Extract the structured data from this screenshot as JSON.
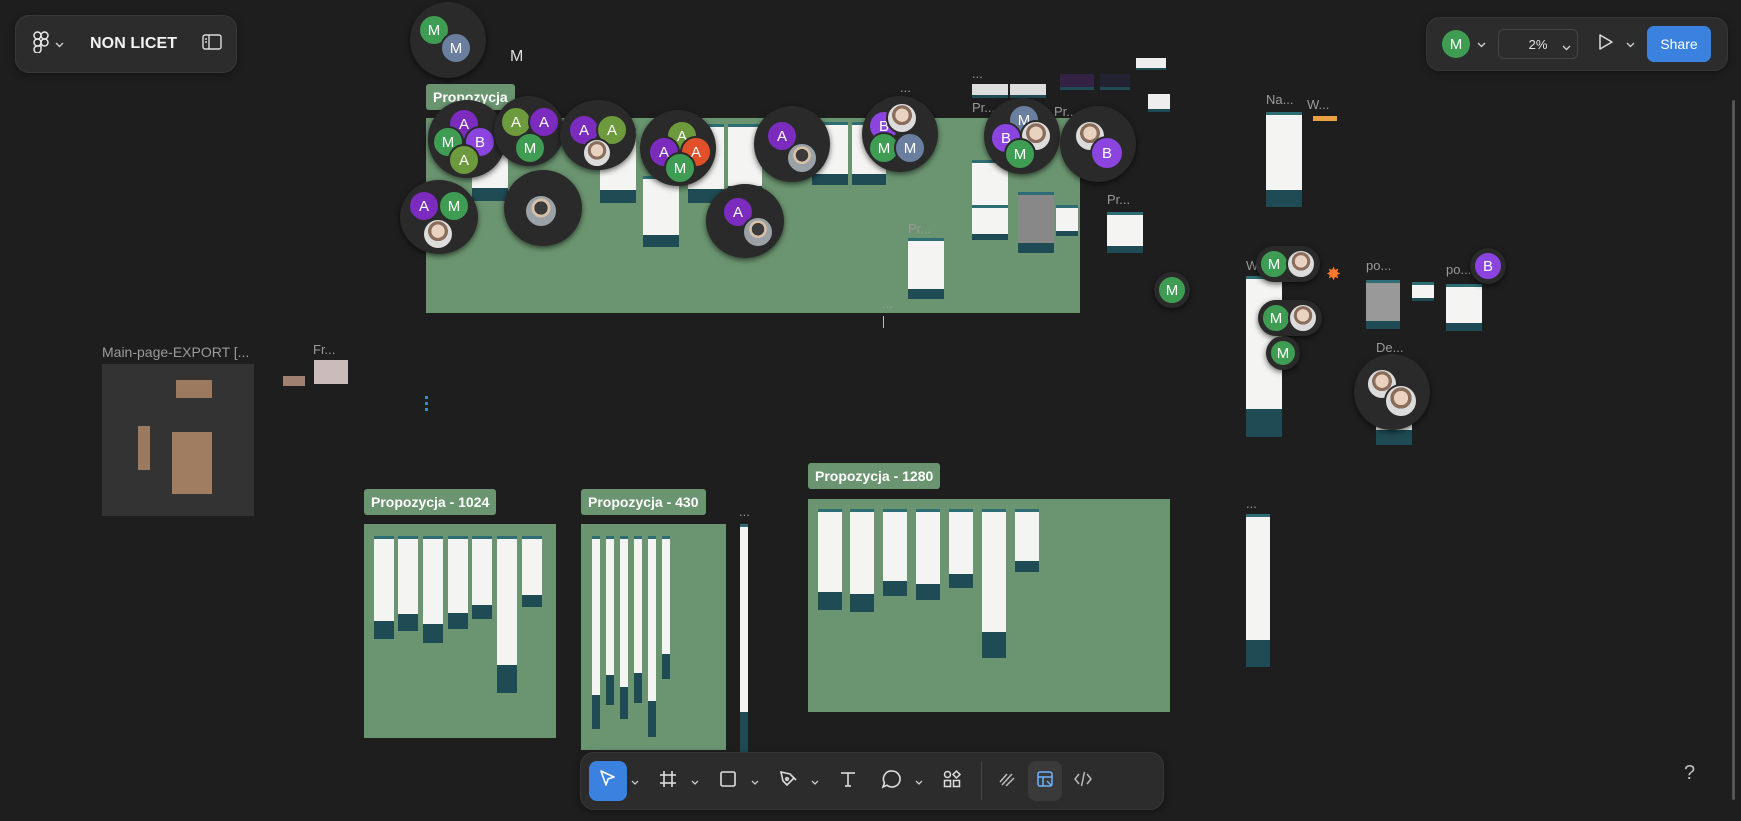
{
  "toolbar": {
    "file_name": "NON LICET",
    "zoom_level": "2%",
    "share_label": "Share",
    "current_user_initial": "M",
    "icons": [
      "figma-logo-icon",
      "chevron-down-icon",
      "sidebar-toggle-icon",
      "play-icon"
    ]
  },
  "frames": [
    {
      "label": "Propozycja - 1024"
    },
    {
      "label": "Propozycja - 430"
    },
    {
      "label": "Propozycja - 1280"
    },
    {
      "label": "Propozycja"
    }
  ],
  "captions": {
    "main_export": "Main-page-EXPORT [...",
    "fr": "Fr...",
    "pr1": "Pr...",
    "pr2": "Pr...",
    "pr3": "Pr...",
    "pr4": "Pr...",
    "dots1": "...",
    "dots2": "...",
    "dots3": "...",
    "dots4": "...",
    "na": "Na...",
    "w1": "W...",
    "w2": "W",
    "po1": "po...",
    "po2": "po...",
    "de": "De...",
    "m_top": "M"
  },
  "avatars": {
    "a": "A",
    "b": "B",
    "m": "M"
  },
  "colors": {
    "canvas": "#1e1e1e",
    "panel": "#2c2c2c",
    "frame_green": "#6b9570",
    "accent_blue": "#3b82e0",
    "avatar_green": "#3f9d53",
    "avatar_purple": "#7b2bbd",
    "avatar_violet": "#8b44e0",
    "avatar_slate": "#6a7ea0",
    "avatar_olive": "#6d9a3c",
    "avatar_red": "#e2502a"
  },
  "bottom_toolbar": {
    "tools": [
      "move-tool",
      "frame-tool",
      "rectangle-tool",
      "pen-tool",
      "text-tool",
      "comment-tool",
      "actions-tool"
    ],
    "modes": [
      "draw-mode",
      "design-mode",
      "dev-mode"
    ]
  },
  "help_label": "?"
}
